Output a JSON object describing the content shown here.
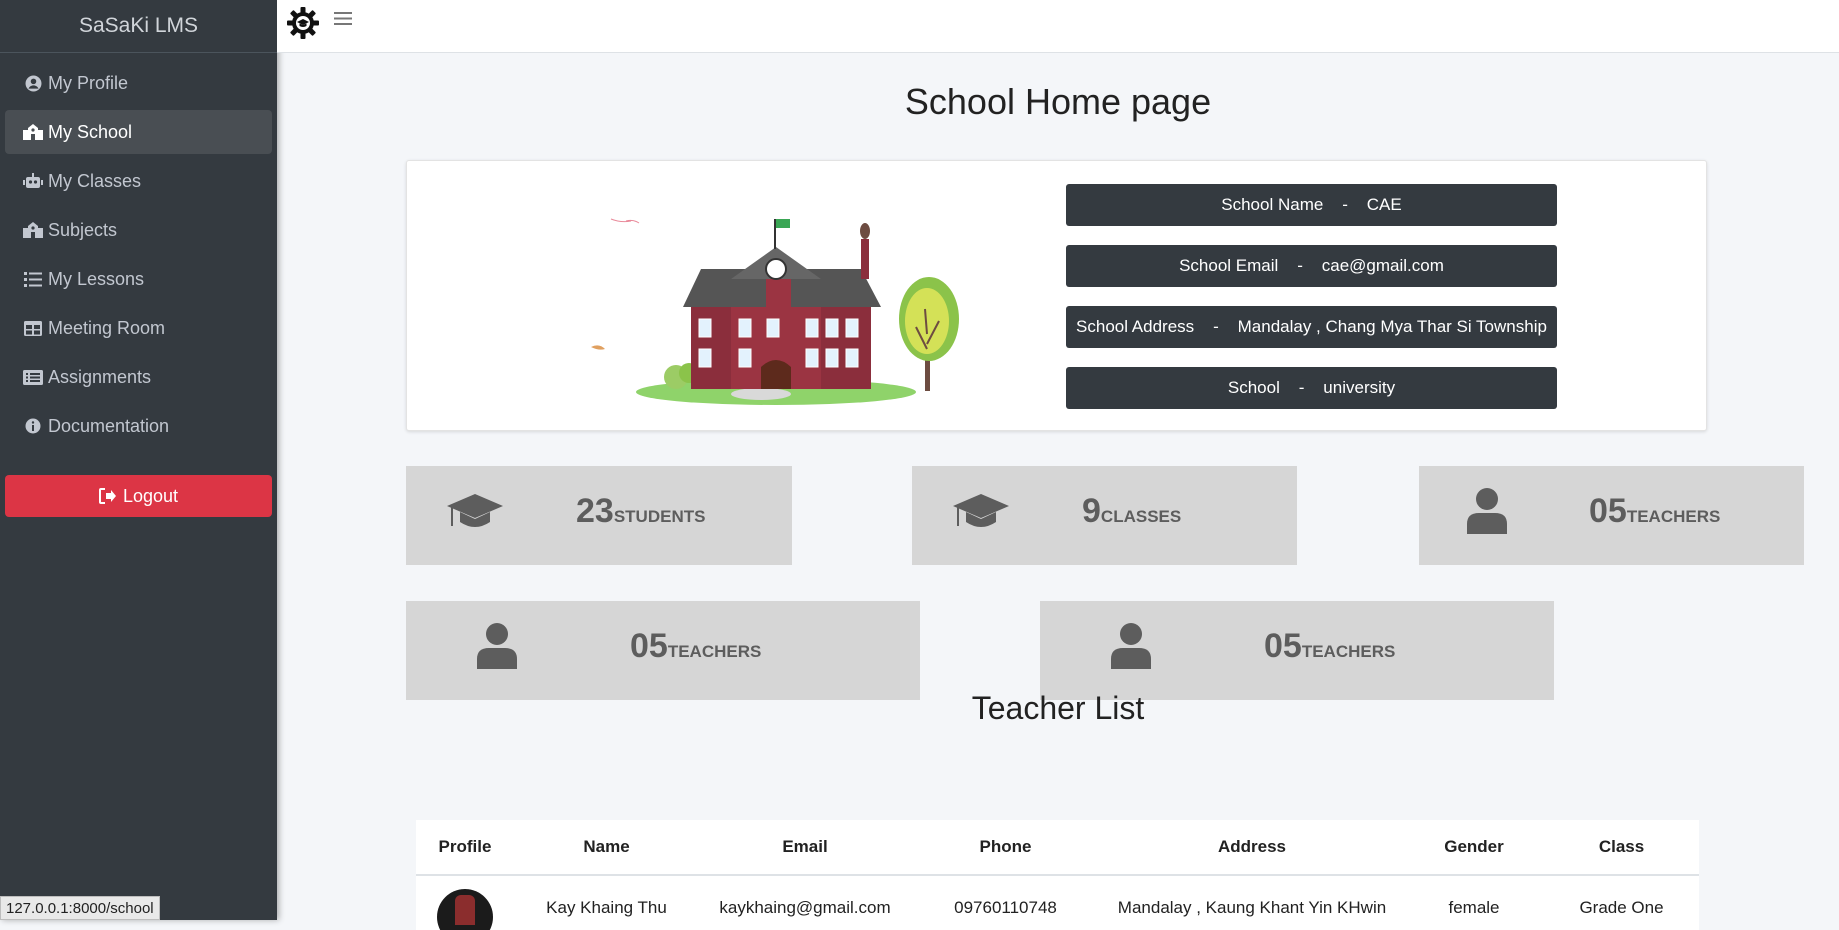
{
  "app": {
    "brand": "SaSaKi LMS"
  },
  "sidebar": {
    "items": [
      {
        "label": "My Profile",
        "icon": "user-circle-icon"
      },
      {
        "label": "My School",
        "icon": "school-icon"
      },
      {
        "label": "My Classes",
        "icon": "robot-icon"
      },
      {
        "label": "Subjects",
        "icon": "school-icon"
      },
      {
        "label": "My Lessons",
        "icon": "list-icon"
      },
      {
        "label": "Meeting Room",
        "icon": "table-icon"
      },
      {
        "label": "Assignments",
        "icon": "list-alt-icon"
      },
      {
        "label": "Documentation",
        "icon": "info-circle-icon"
      }
    ],
    "logout_label": "Logout"
  },
  "main": {
    "title": "School Home page",
    "school_info": [
      "School Name    -    CAE",
      "School Email    -    cae@gmail.com",
      "School Address    -    Mandalay , Chang Mya Thar Si Township",
      "School    -    university"
    ],
    "stats": [
      {
        "value": "23",
        "label": "STUDENTS",
        "icon": "graduation-cap-icon"
      },
      {
        "value": "9",
        "label": "CLASSES",
        "icon": "graduation-cap-icon"
      },
      {
        "value": "05",
        "label": "TEACHERS",
        "icon": "user-icon"
      },
      {
        "value": "05",
        "label": "TEACHERS",
        "icon": "user-icon"
      },
      {
        "value": "05",
        "label": "TEACHERS",
        "icon": "user-icon"
      }
    ],
    "teacher_list_title": "Teacher List",
    "table": {
      "headers": [
        "Profile",
        "Name",
        "Email",
        "Phone",
        "Address",
        "Gender",
        "Class"
      ],
      "rows": [
        {
          "name": "Kay Khaing Thu",
          "email": "kaykhaing@gmail.com",
          "phone": "09760110748",
          "address": "Mandalay , Kaung Khant Yin KHwin",
          "gender": "female",
          "class": "Grade One"
        }
      ]
    }
  },
  "statusbar": {
    "url": "127.0.0.1:8000/school"
  },
  "colors": {
    "sidebar": "#343a40",
    "logout": "#dc3545",
    "stat_bg": "#d6d6d6"
  }
}
